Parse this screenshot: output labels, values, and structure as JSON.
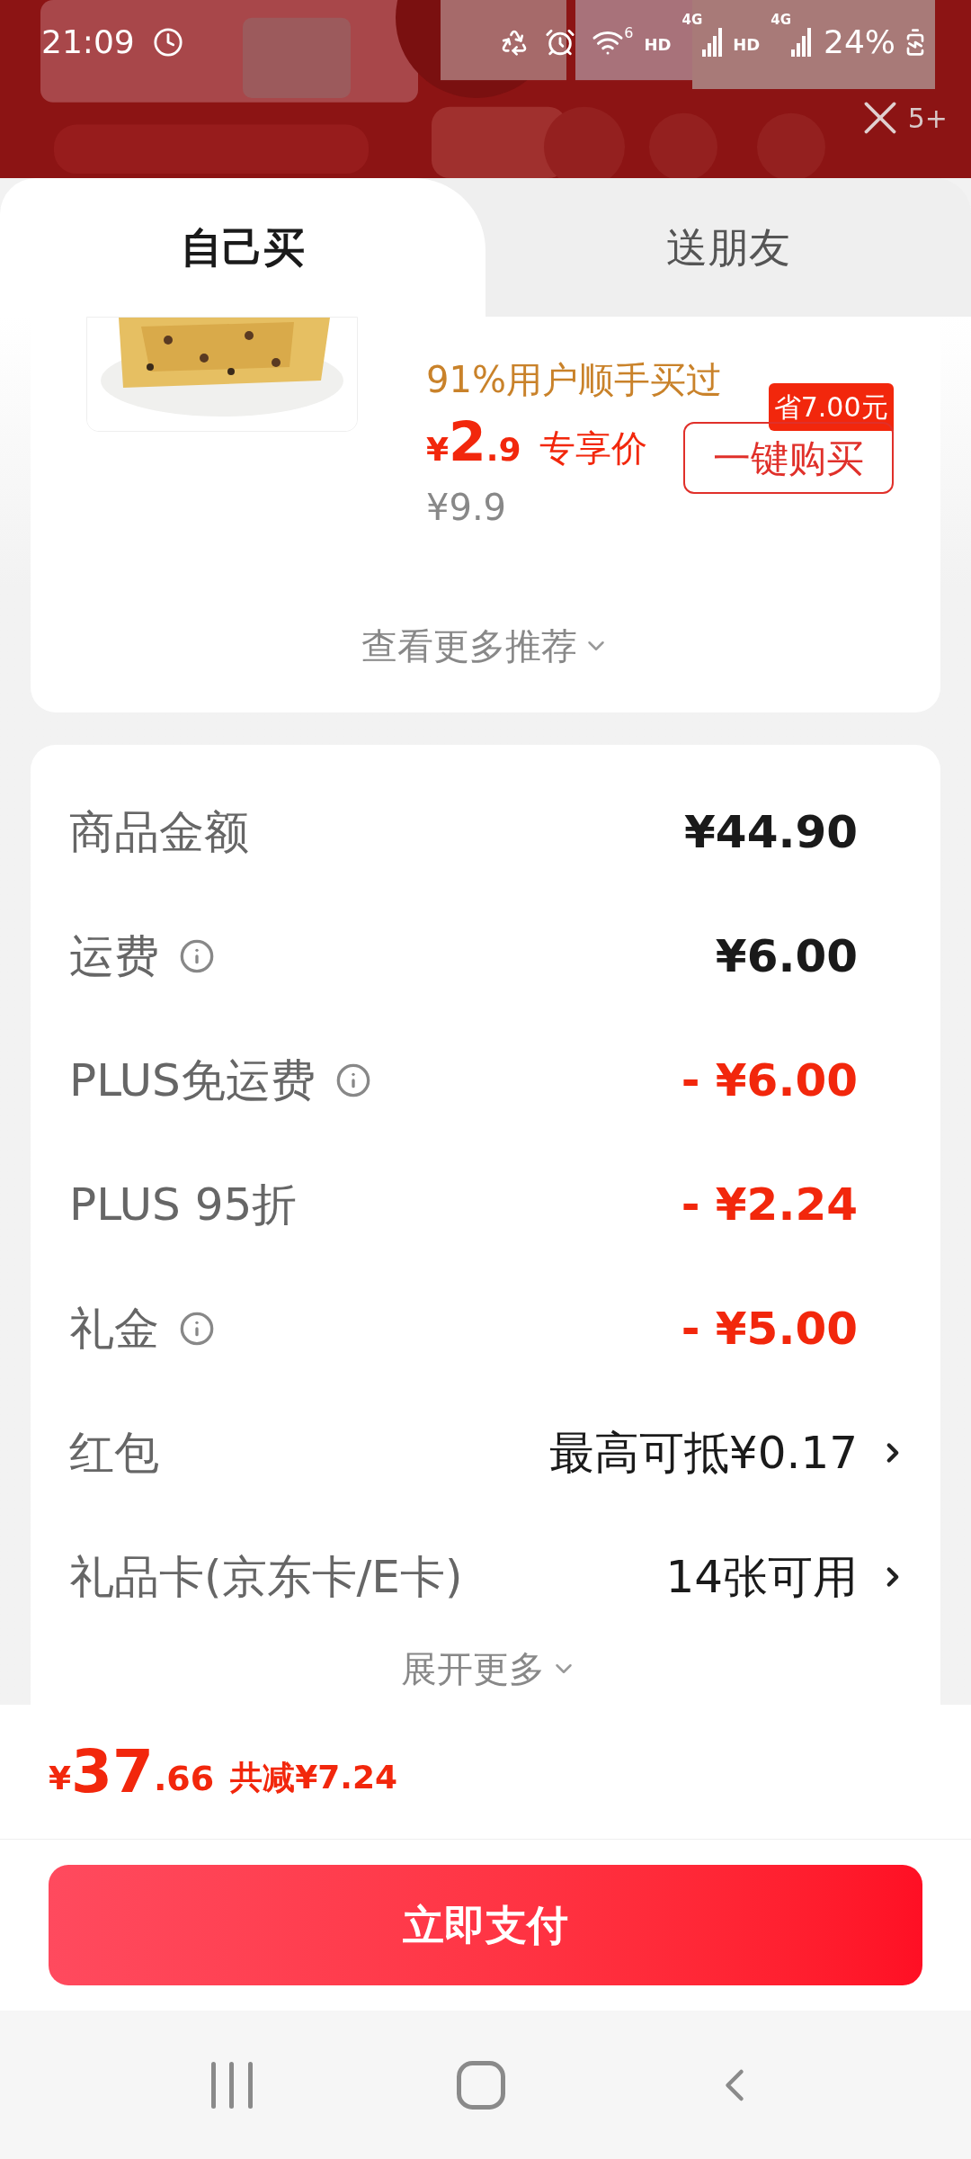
{
  "status_bar": {
    "time": "21:09",
    "wifi_badge": "6",
    "networks": [
      {
        "label": "HD",
        "sub": "4G"
      },
      {
        "label": "HD",
        "sub": "4G"
      }
    ],
    "battery": "24%"
  },
  "header": {
    "close_badge": "5+"
  },
  "tabs": [
    {
      "label": "自己买",
      "selected": true
    },
    {
      "label": "送朋友",
      "selected": false
    }
  ],
  "recommendation": {
    "social_proof": "91%用户顺手买过",
    "price": {
      "currency": "¥",
      "integer": "2",
      "decimal": ".9",
      "tag": "专享价"
    },
    "original_price": "¥9.9",
    "saving_badge": "省7.00元",
    "buy_button": "一键购买",
    "more_link": "查看更多推荐"
  },
  "summary": {
    "rows": [
      {
        "kind": "amount",
        "label": "商品金额",
        "info": false,
        "value": "¥44.90"
      },
      {
        "kind": "amount",
        "label": "运费",
        "info": true,
        "value": "¥6.00"
      },
      {
        "kind": "discount",
        "label": "PLUS免运费",
        "info": true,
        "value": "- ¥6.00"
      },
      {
        "kind": "discount",
        "label": "PLUS 95折",
        "info": false,
        "value": "- ¥2.24"
      },
      {
        "kind": "discount",
        "label": "礼金",
        "info": true,
        "value": "- ¥5.00"
      },
      {
        "kind": "link",
        "label": "红包",
        "info": false,
        "value": "最高可抵¥0.17"
      },
      {
        "kind": "link",
        "label": "礼品卡(京东卡/E卡)",
        "info": false,
        "value": "14张可用"
      }
    ],
    "expand": "展开更多"
  },
  "footer": {
    "total": {
      "currency": "¥",
      "integer": "37",
      "decimal": ".66"
    },
    "savings": "共减¥7.24",
    "pay_button": "立即支付"
  }
}
